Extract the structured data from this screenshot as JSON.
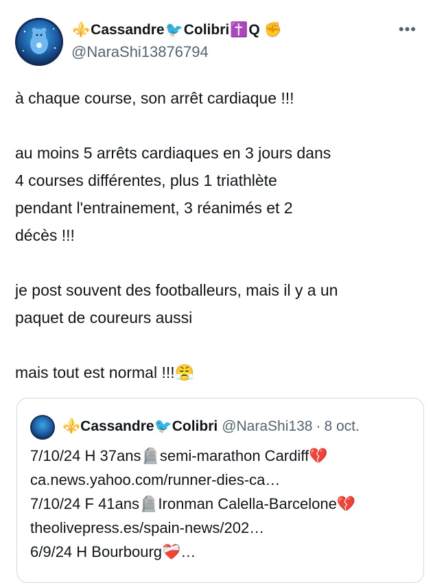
{
  "author": {
    "display_name_parts": [
      "⚜️",
      "Cassandre",
      "🐦",
      "Colibri",
      "✝️",
      "Q",
      "✊"
    ],
    "handle": "@NaraShi13876794"
  },
  "menu_icon": "more-horizontal-icon",
  "tweet": {
    "lines": [
      "à chaque course, son arrêt cardiaque !!!",
      "",
      "au moins 5 arrêts cardiaques en 3 jours dans",
      "4 courses différentes, plus 1 triathlète",
      "pendant l'entrainement, 3 réanimés et 2",
      "décès !!!",
      "",
      "je post souvent des footballeurs, mais il y a un",
      "paquet de coureurs aussi",
      "",
      "mais tout est normal !!!😤"
    ]
  },
  "quote": {
    "display_name_parts": [
      "⚜️",
      "Cassandre",
      "🐦",
      "Colibri"
    ],
    "handle": "@NaraShi138",
    "separator": "·",
    "date": "8 oct.",
    "lines": [
      "7/10/24 H 37ans🪦semi-marathon Cardiff💔",
      "ca.news.yahoo.com/runner-dies-ca…",
      "7/10/24 F 41ans🪦Ironman Calella-Barcelone💔",
      "theolivepress.es/spain-news/202…",
      "6/9/24 H  Bourbourg❤️‍🩹…"
    ]
  }
}
